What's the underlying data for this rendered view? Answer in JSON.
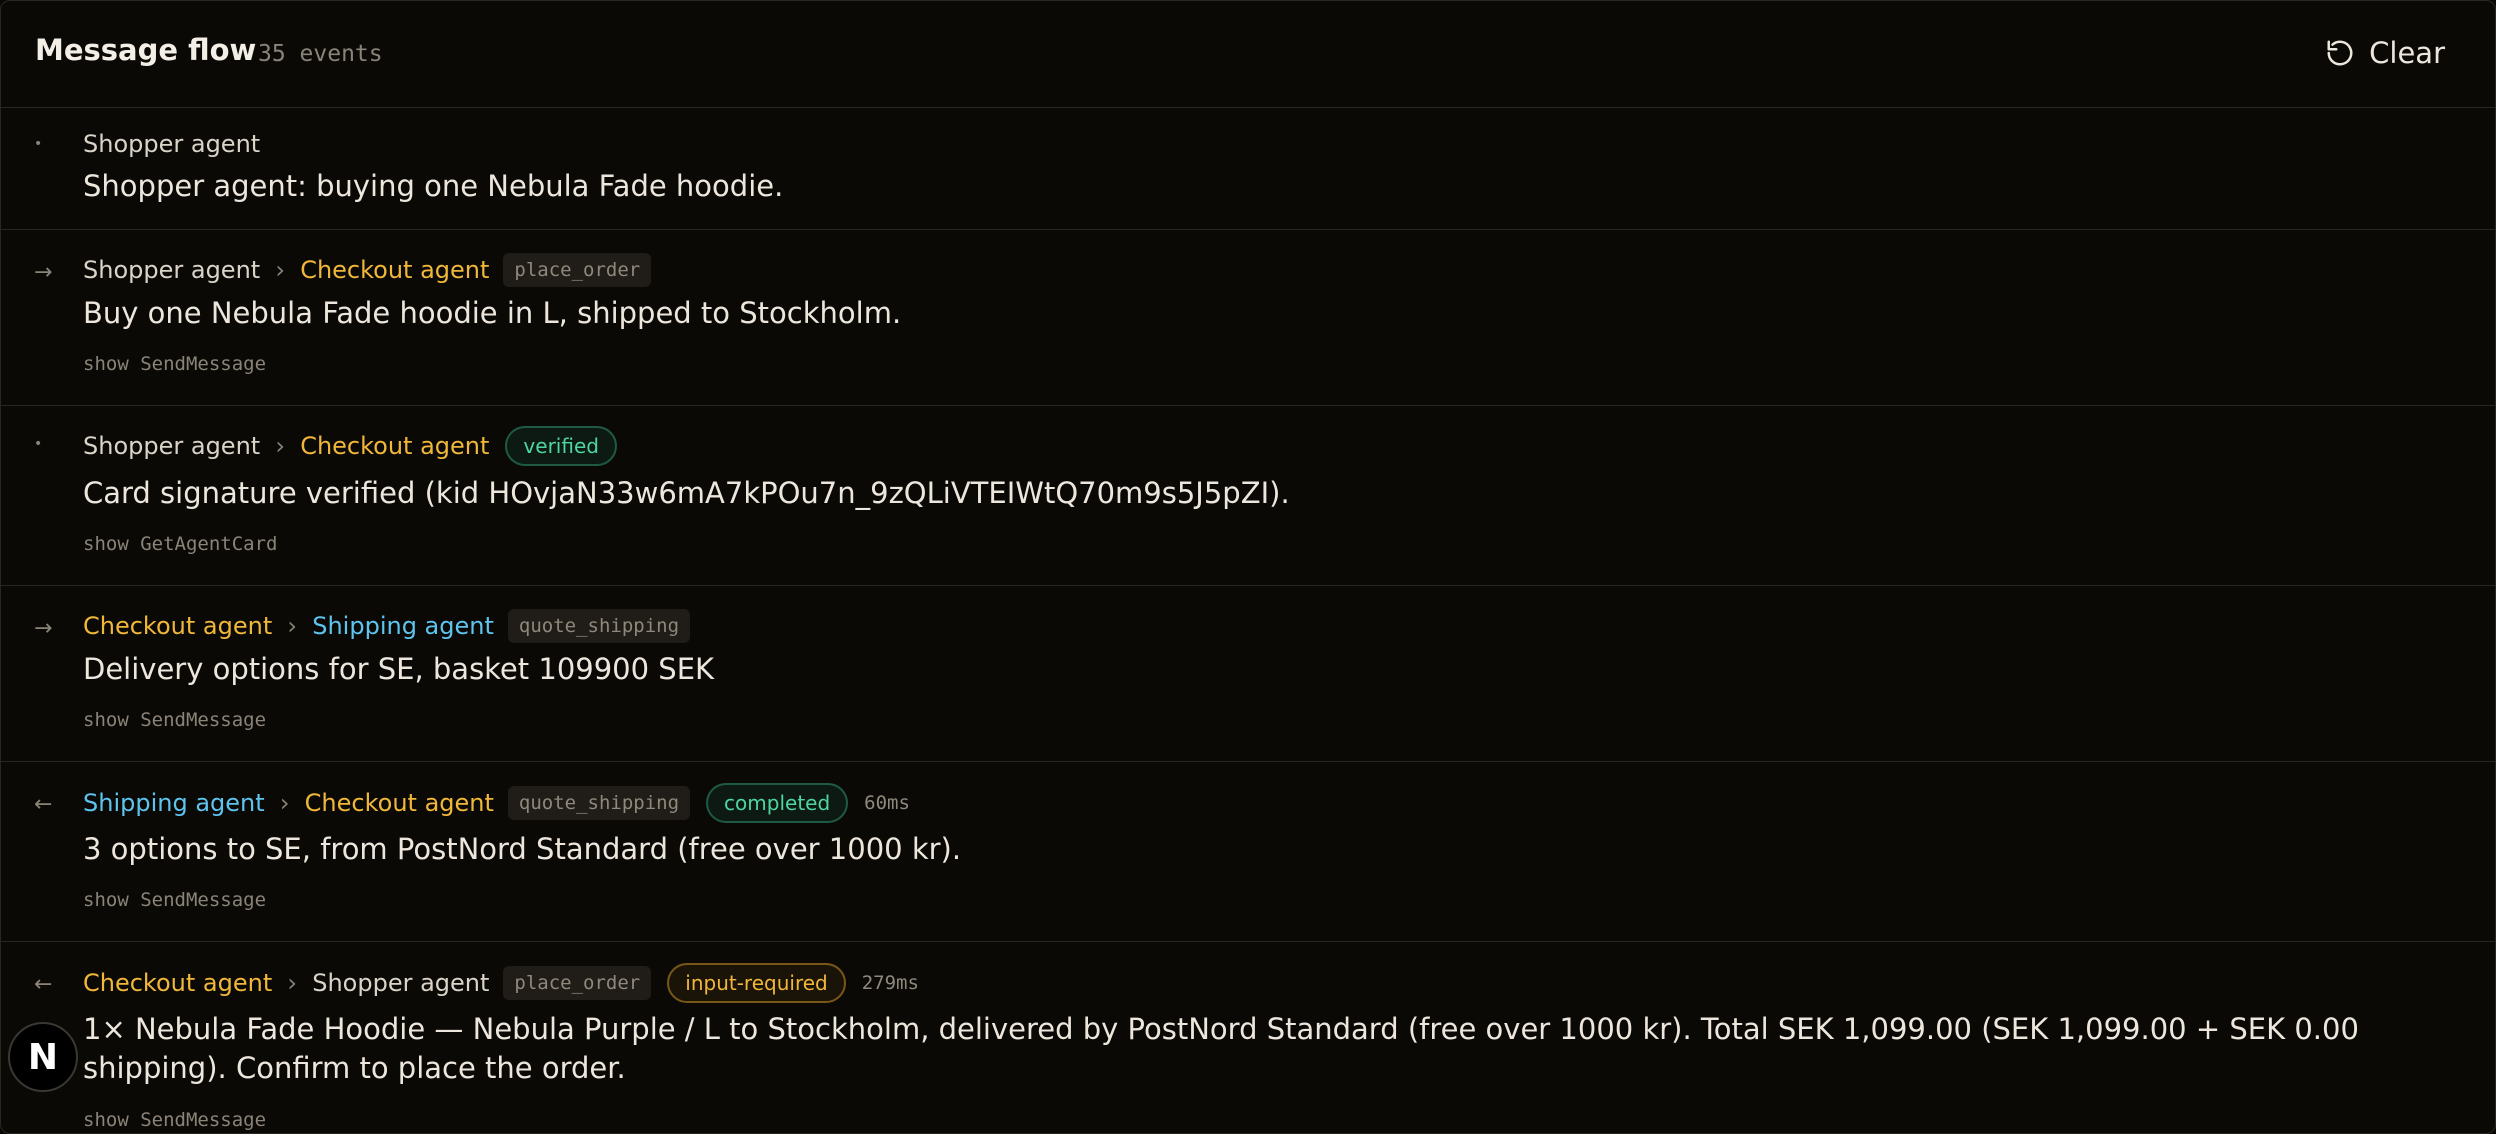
{
  "header": {
    "title": "Message flow",
    "count": "35 events",
    "clear_label": "Clear",
    "clear_icon": "refresh-icon"
  },
  "events": [
    {
      "marker": "•",
      "from": "Shopper agent",
      "message": "Shopper agent: buying one Nebula Fade hoodie."
    },
    {
      "marker": "→",
      "from": "Shopper agent",
      "to": "Checkout agent",
      "chip": "place_order",
      "message": "Buy one Nebula Fade hoodie in L, shipped to Stockholm.",
      "show": "show SendMessage"
    },
    {
      "marker": "•",
      "from": "Shopper agent",
      "to": "Checkout agent",
      "badge": "verified",
      "message": "Card signature verified (kid HOvjaN33w6mA7kPOu7n_9zQLiVTEIWtQ70m9s5J5pZI).",
      "show": "show GetAgentCard"
    },
    {
      "marker": "→",
      "from": "Checkout agent",
      "to": "Shipping agent",
      "chip": "quote_shipping",
      "message": "Delivery options for SE, basket 109900 SEK",
      "show": "show SendMessage"
    },
    {
      "marker": "←",
      "from": "Shipping agent",
      "to": "Checkout agent",
      "chip": "quote_shipping",
      "badge": "completed",
      "duration": "60ms",
      "message": "3 options to SE, from PostNord Standard (free over 1000 kr).",
      "show": "show SendMessage"
    },
    {
      "marker": "←",
      "from": "Checkout agent",
      "to": "Shopper agent",
      "chip": "place_order",
      "badge": "input-required",
      "duration": "279ms",
      "message": "1× Nebula Fade Hoodie — Nebula Purple / L to Stockholm, delivered by PostNord Standard (free over 1000 kr). Total SEK 1,099.00 (SEK 1,099.00 + SEK 0.00 shipping). Confirm to place the order.",
      "show": "show SendMessage"
    }
  ],
  "logo": {
    "letter": "N",
    "icon": "nextjs-logo-icon"
  },
  "colors": {
    "shopper": "#d9d3c8",
    "checkout": "#f0b73a",
    "shipping": "#5ec4ee",
    "success": "#4ed5a0",
    "warning": "#f0b73a",
    "background": "#0b0906"
  }
}
